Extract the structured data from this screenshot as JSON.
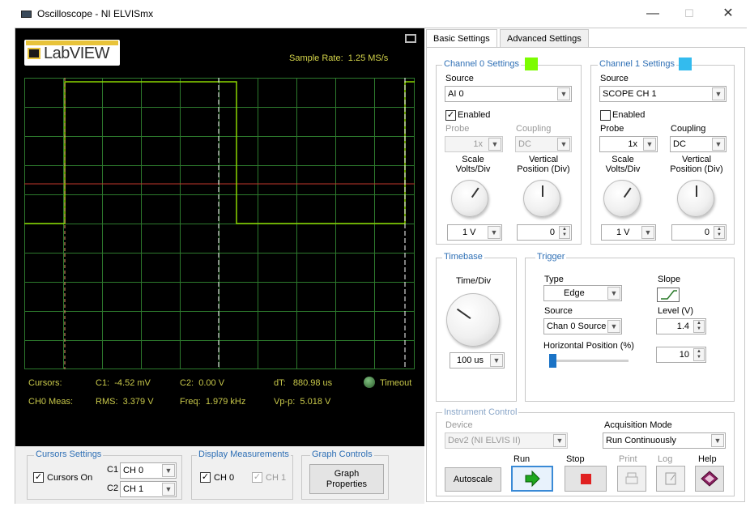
{
  "window": {
    "title": "Oscilloscope - NI ELVISmx",
    "minimize": "—",
    "maximize": "☐",
    "close": "✕"
  },
  "scope": {
    "logo": "LabVIEW",
    "sample_rate_label": "Sample Rate:",
    "sample_rate_value": "1.25 MS/s",
    "cursors_label": "Cursors:",
    "c1_label": "C1:",
    "c1_value": "-4.52 mV",
    "c2_label": "C2:",
    "c2_value": "0.00 V",
    "dt_label": "dT:",
    "dt_value": "880.98 us",
    "timeout_label": "Timeout",
    "ch0_meas_label": "CH0 Meas:",
    "rms_label": "RMS:",
    "rms_value": "3.379 V",
    "freq_label": "Freq:",
    "freq_value": "1.979 kHz",
    "vpp_label": "Vp-p:",
    "vpp_value": "5.018 V"
  },
  "bottom": {
    "cursors_settings": {
      "title": "Cursors Settings",
      "cursors_on_label": "Cursors On",
      "cursors_on_checked": "✓",
      "c1_label": "C1",
      "c1_value": "CH 0",
      "c2_label": "C2",
      "c2_value": "CH 1"
    },
    "display_measurements": {
      "title": "Display Measurements",
      "ch0_label": "CH 0",
      "ch0_checked": "✓",
      "ch1_label": "CH 1",
      "ch1_checked": "✓"
    },
    "graph_controls": {
      "title": "Graph Controls",
      "graph_properties_line1": "Graph",
      "graph_properties_line2": "Properties"
    }
  },
  "tabs": [
    {
      "label": "Basic Settings"
    },
    {
      "label": "Advanced Settings"
    }
  ],
  "channel0": {
    "title": "Channel 0 Settings",
    "color": "#7cfc00",
    "source_label": "Source",
    "source_value": "AI 0",
    "enabled_label": "Enabled",
    "enabled_checked": "✓",
    "probe_label": "Probe",
    "probe_value": "1x",
    "coupling_label": "Coupling",
    "coupling_value": "DC",
    "scale_label_1": "Scale",
    "scale_label_2": "Volts/Div",
    "vpos_label_1": "Vertical",
    "vpos_label_2": "Position (Div)",
    "scale_value": "1 V",
    "vpos_value": "0"
  },
  "channel1": {
    "title": "Channel 1 Settings",
    "color": "#33bbee",
    "source_label": "Source",
    "source_value": "SCOPE CH 1",
    "enabled_label": "Enabled",
    "enabled_checked": "",
    "probe_label": "Probe",
    "probe_value": "1x",
    "coupling_label": "Coupling",
    "coupling_value": "DC",
    "scale_label_1": "Scale",
    "scale_label_2": "Volts/Div",
    "vpos_label_1": "Vertical",
    "vpos_label_2": "Position (Div)",
    "scale_value": "1 V",
    "vpos_value": "0"
  },
  "timebase": {
    "title": "Timebase",
    "label": "Time/Div",
    "value": "100 us"
  },
  "trigger": {
    "title": "Trigger",
    "type_label": "Type",
    "type_value": "Edge",
    "slope_label": "Slope",
    "source_label": "Source",
    "source_value": "Chan 0 Source",
    "level_label": "Level (V)",
    "level_value": "1.4",
    "hpos_label": "Horizontal Position (%)",
    "hpos_value": "10"
  },
  "instrument": {
    "title": "Instrument Control",
    "device_label": "Device",
    "device_value": "Dev2 (NI ELVIS II)",
    "acq_label": "Acquisition Mode",
    "acq_value": "Run Continuously",
    "autoscale": "Autoscale",
    "run": "Run",
    "stop": "Stop",
    "print": "Print",
    "log": "Log",
    "help": "Help"
  }
}
